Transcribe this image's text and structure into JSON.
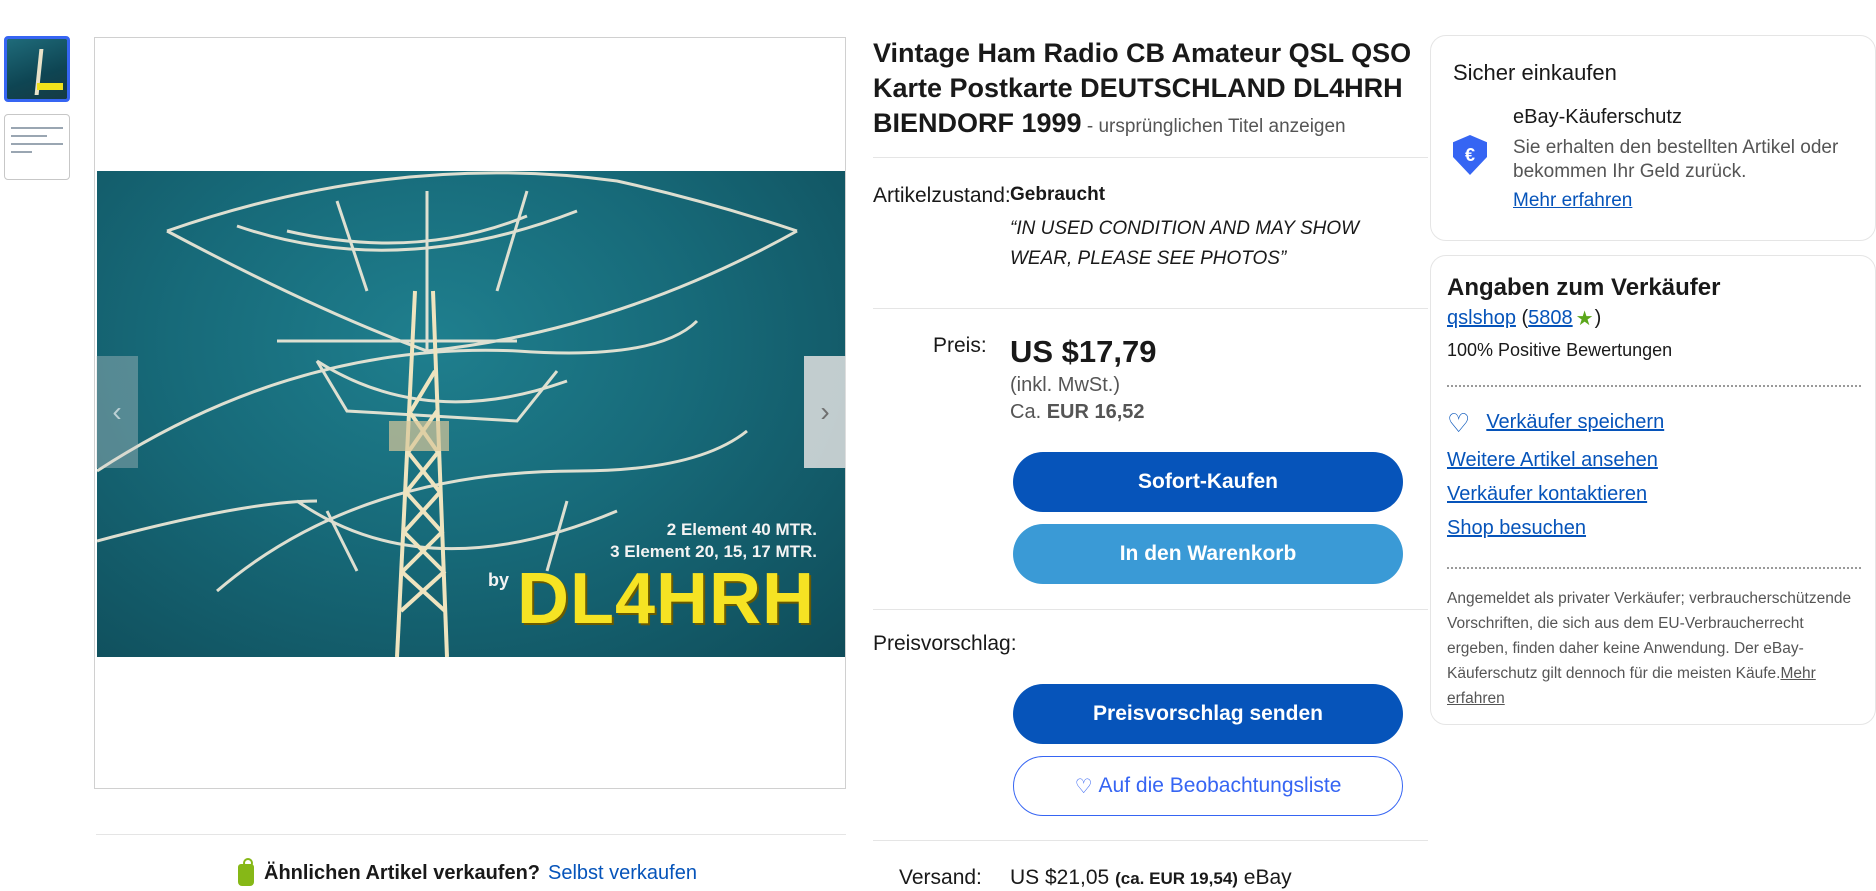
{
  "thumbnails": [
    {
      "alt": "DL4HRH"
    },
    {
      "alt": ""
    }
  ],
  "photo": {
    "caption_line1": "2 Element 40 MTR.",
    "caption_line2": "3 Element 20, 15, 17 MTR.",
    "by": "by",
    "callsign": "DL4HRH"
  },
  "gallery": {
    "prev_icon": "‹",
    "next_icon": "›"
  },
  "sell_similar": {
    "question": "Ähnlichen Artikel verkaufen?",
    "link": "Selbst verkaufen"
  },
  "listing": {
    "title": "Vintage Ham Radio CB Amateur QSL QSO Karte Postkarte DEUTSCHLAND DL4HRH BIENDORF 1999",
    "title_separator": " - ",
    "show_original": "ursprünglichen Titel anzeigen",
    "condition_label": "Artikelzustand:",
    "condition_value": "Gebraucht",
    "condition_quote": "“IN USED CONDITION AND MAY SHOW WEAR, PLEASE SEE PHOTOS”",
    "price_label": "Preis:",
    "price": "US $17,79",
    "price_tax": "(inkl. MwSt.)",
    "price_approx_prefix": "Ca.",
    "price_approx": "EUR 16,52",
    "buy_now": "Sofort-Kaufen",
    "add_to_cart": "In den Warenkorb",
    "offer_label": "Preisvorschlag:",
    "send_offer": "Preisvorschlag senden",
    "watchlist": "Auf die Beobachtungsliste",
    "shipping_label": "Versand:",
    "shipping_price": "US $21,05",
    "shipping_approx": "(ca. EUR 19,54)",
    "shipping_carrier": "eBay"
  },
  "safe_shopping": {
    "title": "Sicher einkaufen",
    "protection_title": "eBay-Käuferschutz",
    "protection_text": "Sie erhalten den bestellten Artikel oder bekommen Ihr Geld zurück.",
    "learn_more": "Mehr erfahren"
  },
  "seller": {
    "title": "Angaben zum Verkäufer",
    "name": "qslshop",
    "feedback_score": "5808",
    "positive": "100% Positive Bewertungen",
    "save_seller": "Verkäufer speichern",
    "more_items": "Weitere Artikel ansehen",
    "contact": "Verkäufer kontaktieren",
    "visit_shop": "Shop besuchen",
    "private_note": "Angemeldet als privater Verkäufer; verbraucherschützende Vorschriften, die sich aus dem EU-Verbraucherrecht ergeben, finden daher keine Anwendung. Der eBay-Käuferschutz gilt dennoch für die meisten Käufe.",
    "private_note_link": "Mehr erfahren"
  },
  "colors": {
    "primary_button": "#0654ba",
    "secondary_button": "#3a9ad6",
    "link": "#0654ba",
    "callsign_yellow": "#f6e323"
  }
}
